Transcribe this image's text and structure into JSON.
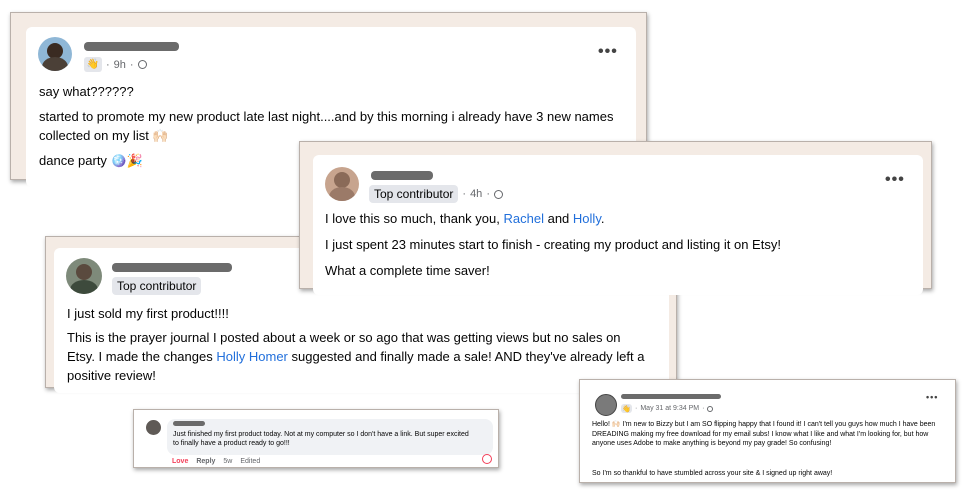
{
  "posts": {
    "p1": {
      "time": "9h",
      "lines": [
        "say what??????",
        "started to promote my new product late last night....and by this morning i already have 3 new names collected on my list 🙌🏻",
        "dance party 🪩🎉"
      ]
    },
    "p2": {
      "badge": "Top contributor",
      "time": "4h",
      "line1_prefix": "I love this so much, thank you,",
      "line1_name1": "Rachel",
      "line1_mid": "and",
      "line1_name2": "Holly",
      "line1_suffix": ".",
      "line2": "I just spent 23 minutes start to finish - creating my product and listing it on Etsy!",
      "line3": "What a complete time saver!"
    },
    "p3": {
      "badge": "Top contributor",
      "line1": "I just sold my first product!!!!",
      "line2_prefix": "This is the prayer journal I posted about a week or so ago that was getting views but no sales on Etsy.  I made the changes",
      "line2_link": "Holly Homer",
      "line2_suffix": "suggested and finally made a sale!  AND they've already left a positive review!"
    },
    "p4": {
      "comment": "Just finished my first product today. Not at my computer so I don't have a link. But super excited to finally have a product ready to go!!!",
      "actions": [
        "Love",
        "Reply",
        "5w",
        "Edited"
      ]
    },
    "p5": {
      "time": "May 31 at 9:34 PM",
      "line1": "Hello! 🙌🏻 I'm new to Bizzy but I am SO flipping happy that I found it! I can't tell you guys how much I have been DREADING making my free download for my email subs!  I know what I like and what I'm looking for, but how anyone uses Adobe to make anything is beyond my pay grade! So confusing!",
      "line2": "So I'm so thankful to have stumbled across your site & I signed up right away!"
    }
  },
  "icons": {
    "more": "more-options-icon",
    "globe": "globe-icon",
    "reaction": "heart-reaction-icon"
  },
  "colors": {
    "link": "#216fdb",
    "card_frame": "#f4ebe4",
    "love": "#f33e58"
  }
}
